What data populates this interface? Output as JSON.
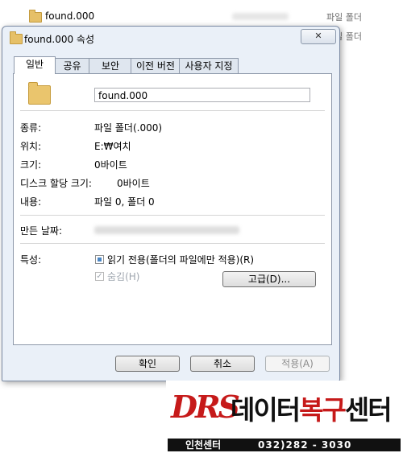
{
  "explorer": {
    "rows": [
      {
        "name": "found.000",
        "type": "파일 폴더"
      },
      {
        "name": "",
        "type": "파일 폴더"
      }
    ]
  },
  "dialog": {
    "title": "found.000 속성",
    "close_label": "✕",
    "tabs": [
      "일반",
      "공유",
      "보안",
      "이전 버전",
      "사용자 지정"
    ],
    "active_tab": "일반",
    "folder_name": "found.000",
    "props": {
      "type_label": "종류:",
      "type_value": "파일 폴더(.000)",
      "location_label": "위치:",
      "location_value": "E:₩여치",
      "size_label": "크기:",
      "size_value": "0바이트",
      "disk_size_label": "디스크 할당 크기:",
      "disk_size_value": "0바이트",
      "contains_label": "내용:",
      "contains_value": "파일 0, 폴더 0",
      "created_label": "만든 날짜:"
    },
    "attributes": {
      "label": "특성:",
      "readonly_label": "읽기 전용(폴더의 파일에만 적용)(R)",
      "hidden_label": "숨김(H)",
      "advanced_label": "고급(D)..."
    },
    "buttons": {
      "ok": "확인",
      "cancel": "취소",
      "apply": "적용(A)"
    }
  },
  "logo": {
    "brand": "DRS",
    "text_a": "데이터",
    "text_b": "복구",
    "text_c": "센터",
    "location": "인천센터",
    "phone": "032)282 - 3030"
  },
  "colors": {
    "accent": "#c61a1a",
    "checkbox": "#4a86c5"
  }
}
